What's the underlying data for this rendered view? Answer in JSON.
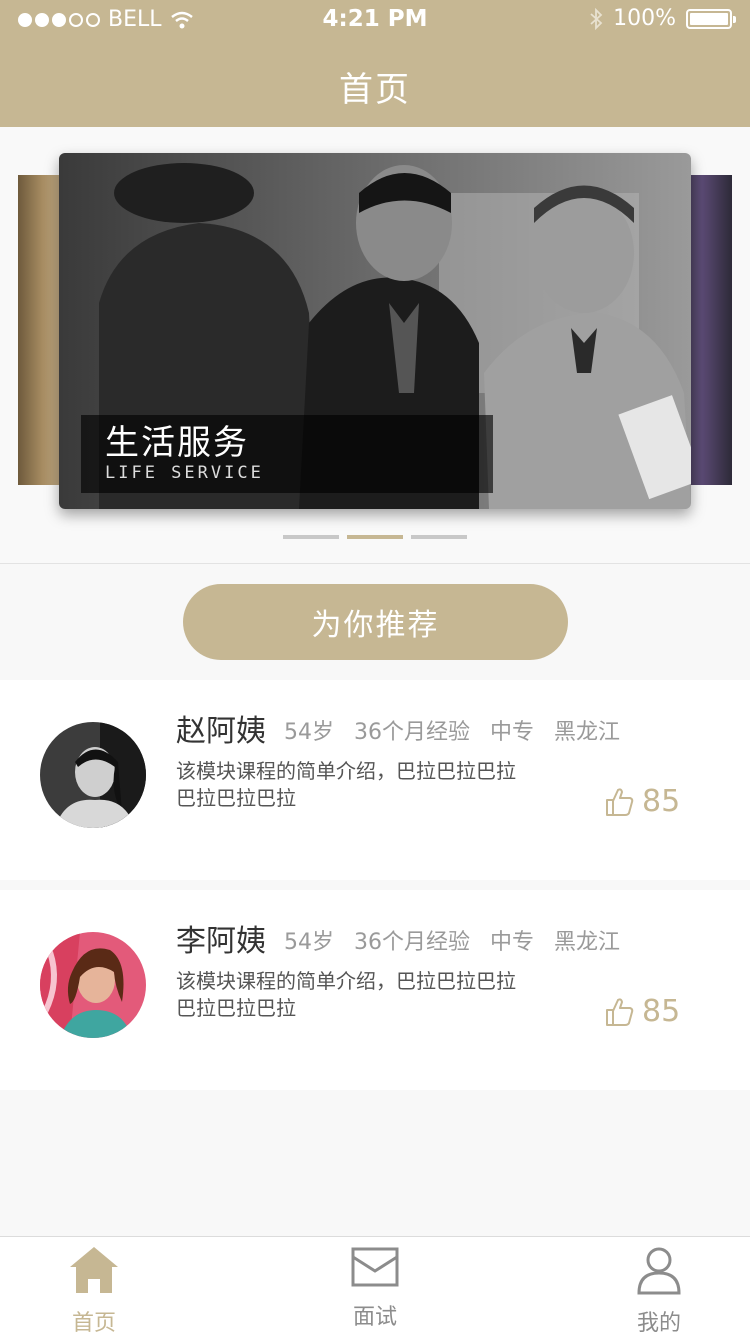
{
  "status_bar": {
    "carrier": "BELL",
    "time": "4:21 PM",
    "battery": "100%"
  },
  "header": {
    "title": "首页"
  },
  "banner": {
    "title_cn": "生活服务",
    "title_en": "LIFE SERVICE",
    "indicator_count": 3,
    "active_index": 1
  },
  "recommend_button": "为你推荐",
  "caregivers": [
    {
      "name": "赵阿姨",
      "age": "54岁",
      "experience": "36个月经验",
      "education": "中专",
      "location": "黑龙江",
      "desc": "该模块课程的简单介绍，巴拉巴拉巴拉巴拉巴拉巴拉",
      "likes": "85"
    },
    {
      "name": "李阿姨",
      "age": "54岁",
      "experience": "36个月经验",
      "education": "中专",
      "location": "黑龙江",
      "desc": "该模块课程的简单介绍，巴拉巴拉巴拉巴拉巴拉巴拉",
      "likes": "85"
    }
  ],
  "tabbar": {
    "home": "首页",
    "interview": "面试",
    "mine": "我的"
  },
  "colors": {
    "accent": "#c6b793",
    "background": "#f8f8f8"
  }
}
